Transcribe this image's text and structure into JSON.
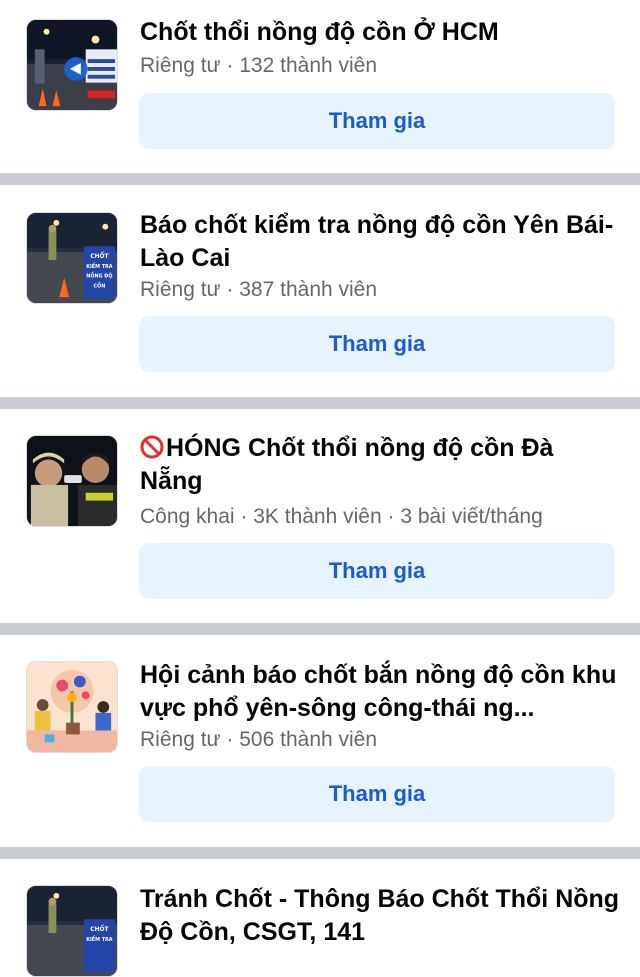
{
  "groups": [
    {
      "title": "Chốt thổi nồng độ cồn Ở HCM",
      "meta": "Riêng tư · 132 thành viên",
      "join_label": "Tham gia",
      "thumb_icon": "police-checkpoint-night-photo"
    },
    {
      "title": "Báo chốt kiểm tra nồng độ cồn Yên Bái-Lào Cai",
      "meta": "Riêng tư · 387 thành viên",
      "join_label": "Tham gia",
      "thumb_icon": "checkpoint-sign-photo",
      "thumb_sign": [
        "CHỐT",
        "KIỂM TRA",
        "NỒNG ĐỘ",
        "CỒN"
      ]
    },
    {
      "title_prefix_icon": "no-entry-icon",
      "title": "HÓNG Chốt thổi nồng độ cồn Đà Nẵng",
      "meta": "Công khai · 3K thành viên · 3 bài viết/tháng",
      "join_label": "Tham gia",
      "thumb_icon": "breathalyzer-test-photo"
    },
    {
      "title": "Hội cảnh báo chốt bắn nồng độ cồn khu vực phổ yên-sông công-thái ng...",
      "meta": "Riêng tư · 506 thành viên",
      "join_label": "Tham gia",
      "thumb_icon": "gardening-illustration"
    },
    {
      "title": "Tránh Chốt - Thông Báo Chốt Thổi Nồng Độ Cồn, CSGT, 141",
      "meta": "",
      "join_label": "",
      "thumb_icon": "checkpoint-sign-photo",
      "thumb_sign": [
        "CHỐT",
        "KIỂM TRA"
      ]
    }
  ],
  "colors": {
    "separator": "#c9ccd1",
    "button_bg": "#e7f3ff",
    "button_text": "#1b5bd1",
    "title_text": "#050505",
    "meta_text": "#65676b"
  }
}
